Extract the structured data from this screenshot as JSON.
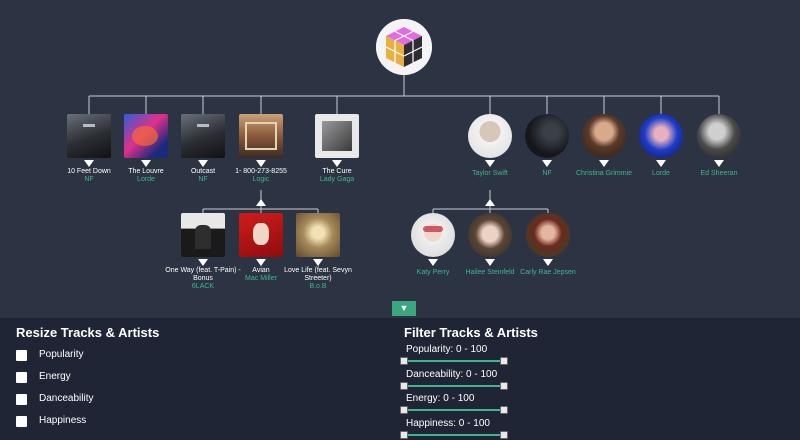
{
  "tracks_top": [
    {
      "title": "10 Feet Down",
      "artist": "NF"
    },
    {
      "title": "The Louvre",
      "artist": "Lorde"
    },
    {
      "title": "Outcast",
      "artist": "NF"
    },
    {
      "title": "1- 800-273-8255",
      "artist": "Logic"
    },
    {
      "title": "The Cure",
      "artist": "Lady Gaga"
    }
  ],
  "tracks_child": [
    {
      "title": "One Way (feat. T-Pain) - Bonus",
      "artist": "6LACK"
    },
    {
      "title": "Avian",
      "artist": "Mac Miller"
    },
    {
      "title": "Love Life (feat. Sevyn Streeter)",
      "artist": "B.o.B"
    }
  ],
  "artists_top": [
    "Taylor Swift",
    "NF",
    "Christina Grimmie",
    "Lorde",
    "Ed Sheeran"
  ],
  "artists_child": [
    "Katy Perry",
    "Hailee Steinfeld",
    "Carly Rae Jepsen"
  ],
  "expand_icon": "▼",
  "resize": {
    "title": "Resize Tracks & Artists",
    "options": [
      "Popularity",
      "Energy",
      "Danceability",
      "Happiness"
    ]
  },
  "filter": {
    "title": "Filter Tracks & Artists",
    "items": [
      {
        "label": "Popularity: 0 - 100",
        "min": 0,
        "max": 100
      },
      {
        "label": "Danceability: 0 - 100",
        "min": 0,
        "max": 100
      },
      {
        "label": "Energy: 0 - 100",
        "min": 0,
        "max": 100
      },
      {
        "label": "Happiness: 0 - 100",
        "min": 0,
        "max": 100
      }
    ]
  },
  "colors": {
    "background": "#2c3444",
    "panel": "#1f2535",
    "accent": "#3fb58f",
    "button": "#3aa77e"
  }
}
